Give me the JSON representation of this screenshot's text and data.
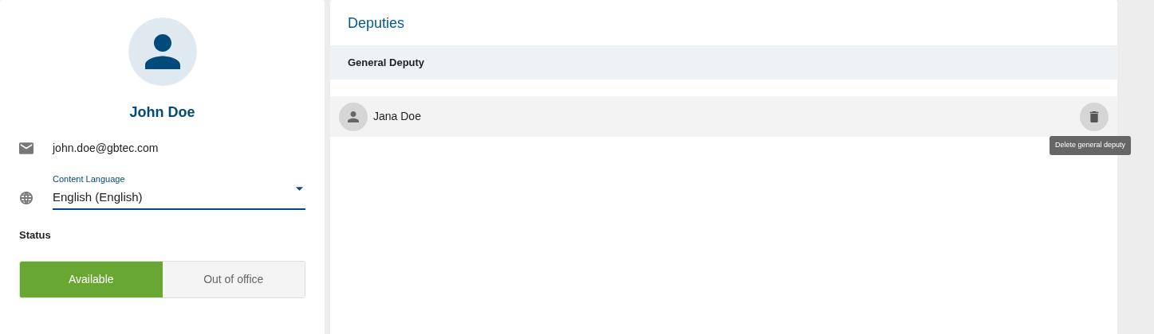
{
  "profile": {
    "name": "John Doe",
    "email": "john.doe@gbtec.com",
    "language_field": {
      "label": "Content Language",
      "value": "English (English)"
    },
    "status_label": "Status",
    "status_options": [
      {
        "label": "Available",
        "selected": true
      },
      {
        "label": "Out of office",
        "selected": false
      }
    ]
  },
  "deputies": {
    "title": "Deputies",
    "section": "General Deputy",
    "items": [
      {
        "name": "Jana Doe",
        "hovered": true
      }
    ],
    "tooltip": "Delete general deputy"
  }
}
